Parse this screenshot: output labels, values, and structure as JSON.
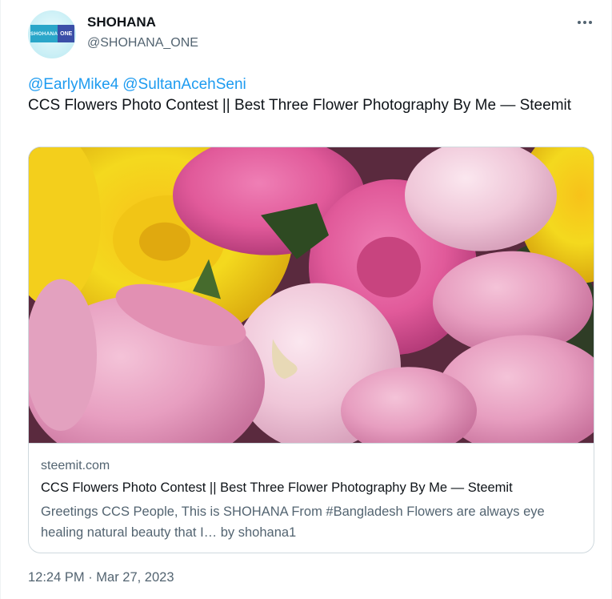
{
  "author": {
    "name": "SHOHANA",
    "handle": "@SHOHANA_ONE",
    "avatar_text_left": "SHOHANA",
    "avatar_text_right": "ONE"
  },
  "tweet": {
    "mentions": [
      "@EarlyMike4",
      "@SultanAcehSeni"
    ],
    "text": "CCS Flowers Photo Contest || Best Three Flower Photography By Me — Steemit"
  },
  "link_card": {
    "image_icon": "flower-photo",
    "domain": "steemit.com",
    "title": "CCS Flowers Photo Contest || Best Three Flower Photography By Me — Steemit",
    "description": "Greetings CCS People, This is SHOHANA From #Bangladesh Flowers are always eye healing natural beauty that I… by shohana1"
  },
  "timestamp": "12:24 PM · Mar 27, 2023",
  "colors": {
    "link": "#1d9bf0",
    "text_primary": "#0f1419",
    "text_secondary": "#536471",
    "border": "#cfd9de"
  },
  "icons": {
    "more_menu": "more-horizontal-icon"
  }
}
